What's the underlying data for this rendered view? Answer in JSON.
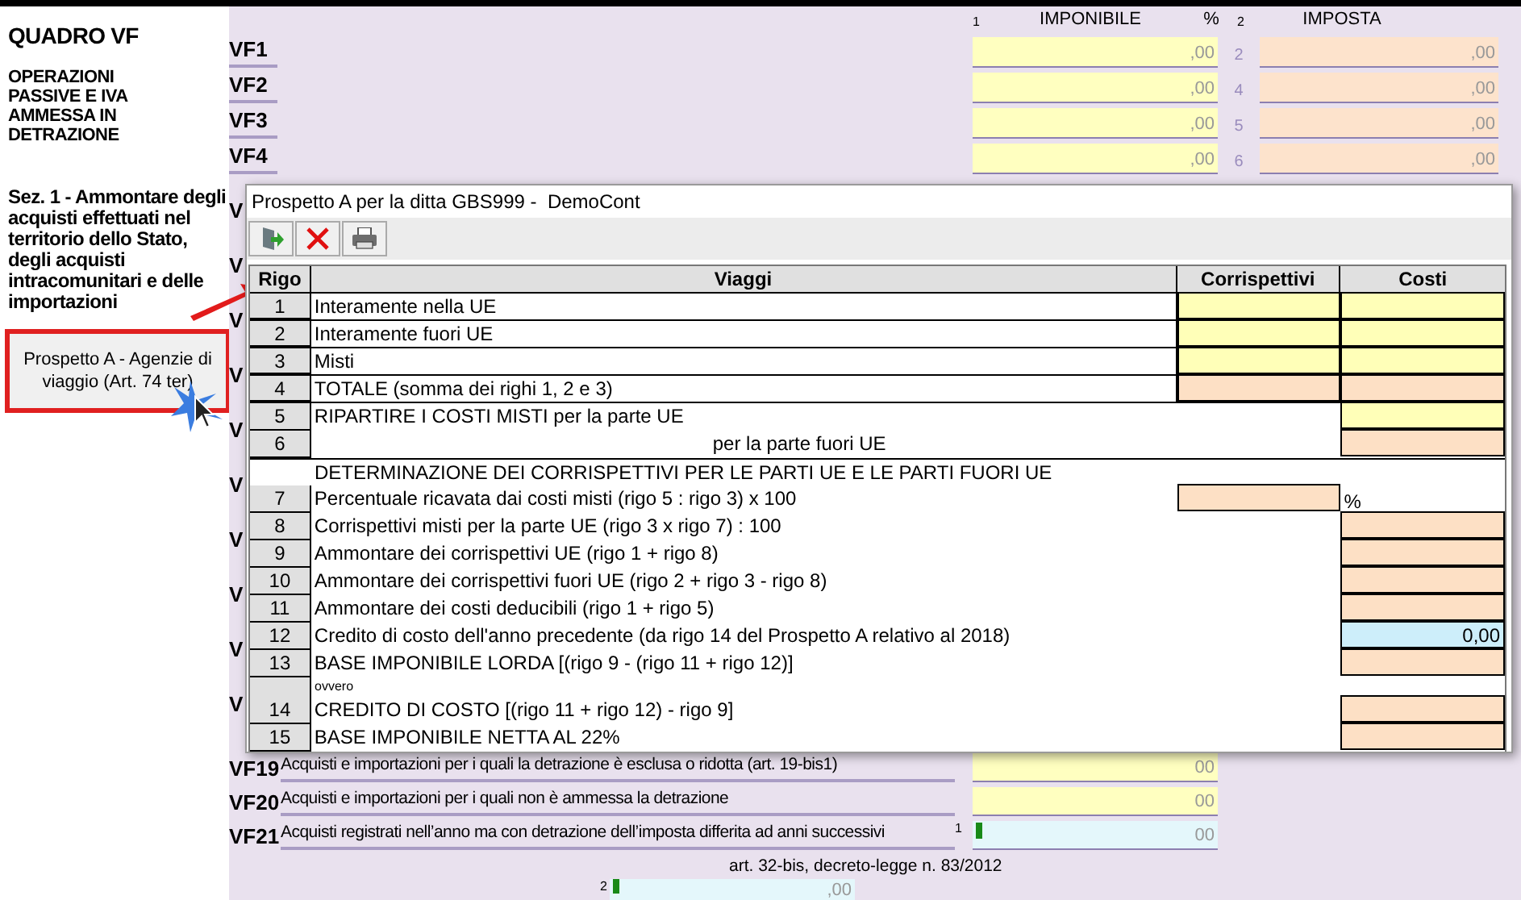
{
  "left_panel": {
    "title": "QUADRO VF",
    "subtitle": "OPERAZIONI PASSIVE E IVA AMMESSA IN DETRAZIONE",
    "section": "Sez. 1 - Ammontare degli acquisti effettuati nel territorio dello Stato, degli acquisti intracomunitari e delle importazioni",
    "prospetto_button": "Prospetto A - Agenzie di viaggio (Art. 74 ter)"
  },
  "form": {
    "header": {
      "imponibile_index": "1",
      "imponibile": "IMPONIBILE",
      "percent": "%",
      "imposta_index": "2",
      "imposta": "IMPOSTA"
    },
    "rows": [
      {
        "code": "VF1",
        "imponibile": ",00",
        "rate": "2",
        "imposta": ",00"
      },
      {
        "code": "VF2",
        "imponibile": ",00",
        "rate": "4",
        "imposta": ",00"
      },
      {
        "code": "VF3",
        "imponibile": ",00",
        "rate": "5",
        "imposta": ",00"
      },
      {
        "code": "VF4",
        "imponibile": ",00",
        "rate": "6",
        "imposta": ",00"
      }
    ],
    "hidden_row_stubs": [
      "V",
      "V",
      "V",
      "V",
      "V",
      "V",
      "V",
      "V",
      "V",
      "V"
    ],
    "bottom_rows": [
      {
        "code": "VF19",
        "label": "Acquisti e importazioni per i quali la detrazione è esclusa o ridotta (art. 19-bis1)",
        "kind": "plain",
        "value": "00"
      },
      {
        "code": "VF20",
        "label": "Acquisti e importazioni per i quali non è ammessa la detrazione",
        "kind": "plain",
        "value": "00"
      },
      {
        "code": "VF21",
        "label": "Acquisti registrati nell’anno ma con detrazione dell’imposta differita ad anni successivi",
        "kind": "deferred",
        "index": "1",
        "value": "00"
      }
    ],
    "note": "art. 32-bis, decreto-legge n. 83/2012",
    "extra_field": {
      "index": "2",
      "value": ",00"
    }
  },
  "dialog": {
    "title": "Prospetto A per la ditta GBS999 -  DemoCont",
    "columns": [
      "Rigo",
      "Viaggi",
      "Corrispettivi",
      "Costi"
    ],
    "rows": [
      {
        "kind": "item",
        "rigo": "1",
        "label": "Interamente nella UE",
        "corrispettivi": {
          "kind": "input"
        },
        "costi": {
          "kind": "input"
        }
      },
      {
        "kind": "item",
        "rigo": "2",
        "label": "Interamente fuori UE",
        "corrispettivi": {
          "kind": "input"
        },
        "costi": {
          "kind": "input"
        }
      },
      {
        "kind": "item",
        "rigo": "3",
        "label": "Misti",
        "corrispettivi": {
          "kind": "input"
        },
        "costi": {
          "kind": "input"
        }
      },
      {
        "kind": "item",
        "rigo": "4",
        "label": "TOTALE (somma dei righi 1, 2 e 3)",
        "corrispettivi": {
          "kind": "computed"
        },
        "costi": {
          "kind": "computed"
        }
      },
      {
        "kind": "item",
        "rigo": "5",
        "label": "RIPARTIRE I COSTI MISTI per la parte UE",
        "costi": {
          "kind": "input"
        }
      },
      {
        "kind": "item",
        "rigo": "6",
        "label": "per la parte fuori UE",
        "indented": true,
        "costi": {
          "kind": "computed"
        }
      },
      {
        "kind": "heading",
        "label": "DETERMINAZIONE DEI CORRISPETTIVI PER LE PARTI UE E LE PARTI FUORI UE"
      },
      {
        "kind": "item",
        "rigo": "7",
        "label": "Percentuale ricavata dai costi misti (rigo 5 : rigo 3) x 100",
        "corrispettivi": {
          "kind": "computed"
        },
        "costi": {
          "kind": "unit",
          "text": "%"
        }
      },
      {
        "kind": "item",
        "rigo": "8",
        "label": "Corrispettivi misti per la parte UE (rigo 3 x rigo 7) : 100",
        "costi": {
          "kind": "computed"
        }
      },
      {
        "kind": "item",
        "rigo": "9",
        "label": "Ammontare dei corrispettivi UE (rigo 1 + rigo 8)",
        "costi": {
          "kind": "computed"
        }
      },
      {
        "kind": "item",
        "rigo": "10",
        "label": "Ammontare dei corrispettivi fuori UE (rigo 2 + rigo 3 - rigo 8)",
        "costi": {
          "kind": "computed"
        }
      },
      {
        "kind": "item",
        "rigo": "11",
        "label": "Ammontare dei costi deducibili (rigo 1 + rigo 5)",
        "costi": {
          "kind": "computed"
        }
      },
      {
        "kind": "item",
        "rigo": "12",
        "label": "Credito di costo dell'anno precedente (da rigo 14 del Prospetto A relativo al 2018)",
        "costi": {
          "kind": "carried",
          "text": "0,00"
        }
      },
      {
        "kind": "item",
        "rigo": "13",
        "label": "BASE IMPONIBILE LORDA [(rigo 9 - (rigo 11 + rigo 12)]",
        "costi": {
          "kind": "computed"
        }
      },
      {
        "kind": "note",
        "label": "ovvero"
      },
      {
        "kind": "item",
        "rigo": "14",
        "label": "CREDITO DI COSTO [(rigo 11 + rigo 12) - rigo 9]",
        "costi": {
          "kind": "computed"
        }
      },
      {
        "kind": "item",
        "rigo": "15",
        "label": "BASE IMPONIBILE NETTA AL 22%",
        "costi": {
          "kind": "computed"
        }
      }
    ]
  }
}
